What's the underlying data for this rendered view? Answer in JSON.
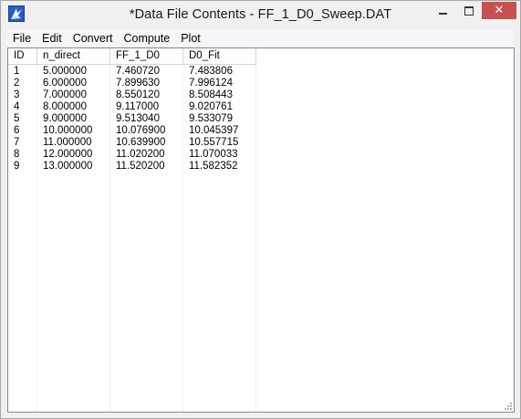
{
  "window": {
    "title": "*Data File Contents - FF_1_D0_Sweep.DAT",
    "close_glyph": "✕"
  },
  "menu": {
    "items": [
      "File",
      "Edit",
      "Convert",
      "Compute",
      "Plot"
    ]
  },
  "table": {
    "columns": [
      "ID",
      "n_direct",
      "FF_1_D0",
      "D0_Fit"
    ],
    "rows": [
      [
        "1",
        "5.000000",
        "7.460720",
        "7.483806"
      ],
      [
        "2",
        "6.000000",
        "7.899630",
        "7.996124"
      ],
      [
        "3",
        "7.000000",
        "8.550120",
        "8.508443"
      ],
      [
        "4",
        "8.000000",
        "9.117000",
        "9.020761"
      ],
      [
        "5",
        "9.000000",
        "9.513040",
        "9.533079"
      ],
      [
        "6",
        "10.000000",
        "10.076900",
        "10.045397"
      ],
      [
        "7",
        "11.000000",
        "10.639900",
        "10.557715"
      ],
      [
        "8",
        "12.000000",
        "11.020200",
        "11.070033"
      ],
      [
        "9",
        "13.000000",
        "11.520200",
        "11.582352"
      ]
    ]
  },
  "colors": {
    "close_button": "#c75050",
    "window_frame": "#f0f0f0",
    "grid_line": "#d5d5d5"
  }
}
